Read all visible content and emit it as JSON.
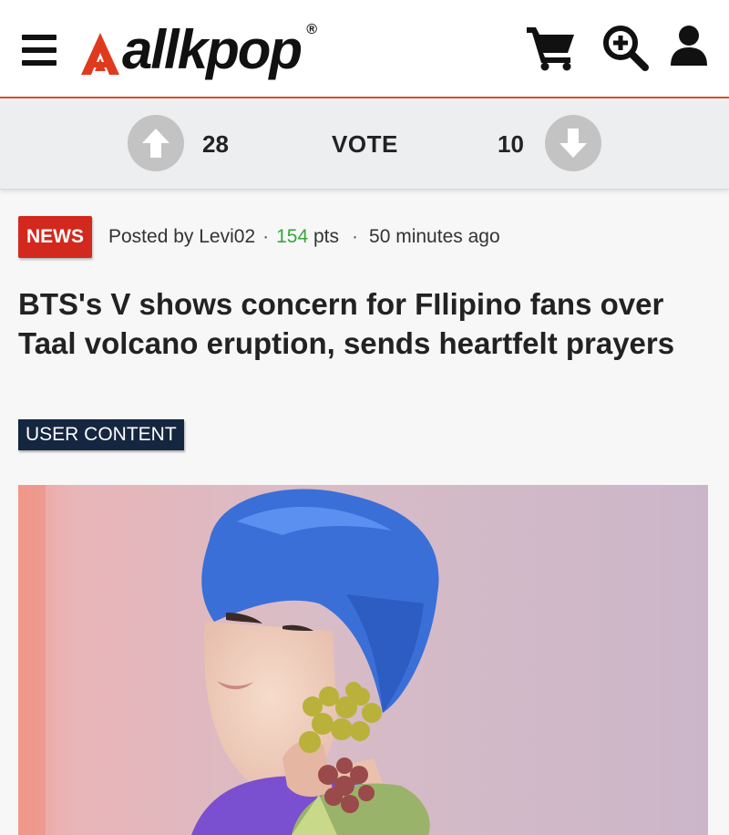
{
  "header": {
    "logo_text": "allkpop",
    "logo_reg": "®",
    "menu_icon": "hamburger-menu-icon",
    "cart_icon": "shopping-cart-icon",
    "search_icon": "zoom-in-search-icon",
    "user_icon": "user-account-icon",
    "accent_color": "#e14a2a"
  },
  "vote": {
    "up_count": "28",
    "label": "VOTE",
    "down_count": "10",
    "up_icon": "arrow-up-icon",
    "down_icon": "arrow-down-icon"
  },
  "article": {
    "category": "NEWS",
    "posted_by_prefix": "Posted by ",
    "author": "Levi02",
    "dot1": "·",
    "points": "154",
    "points_suffix": " pts",
    "dot2": "·",
    "time_ago": "50 minutes ago",
    "title": "BTS's V shows concern for FIlipino fans over Taal volcano eruption, sends heartfelt prayers",
    "content_type": "USER CONTENT"
  },
  "colors": {
    "news_badge": "#d3281d",
    "user_content_badge": "#142640",
    "points_green": "#3aa53a"
  }
}
